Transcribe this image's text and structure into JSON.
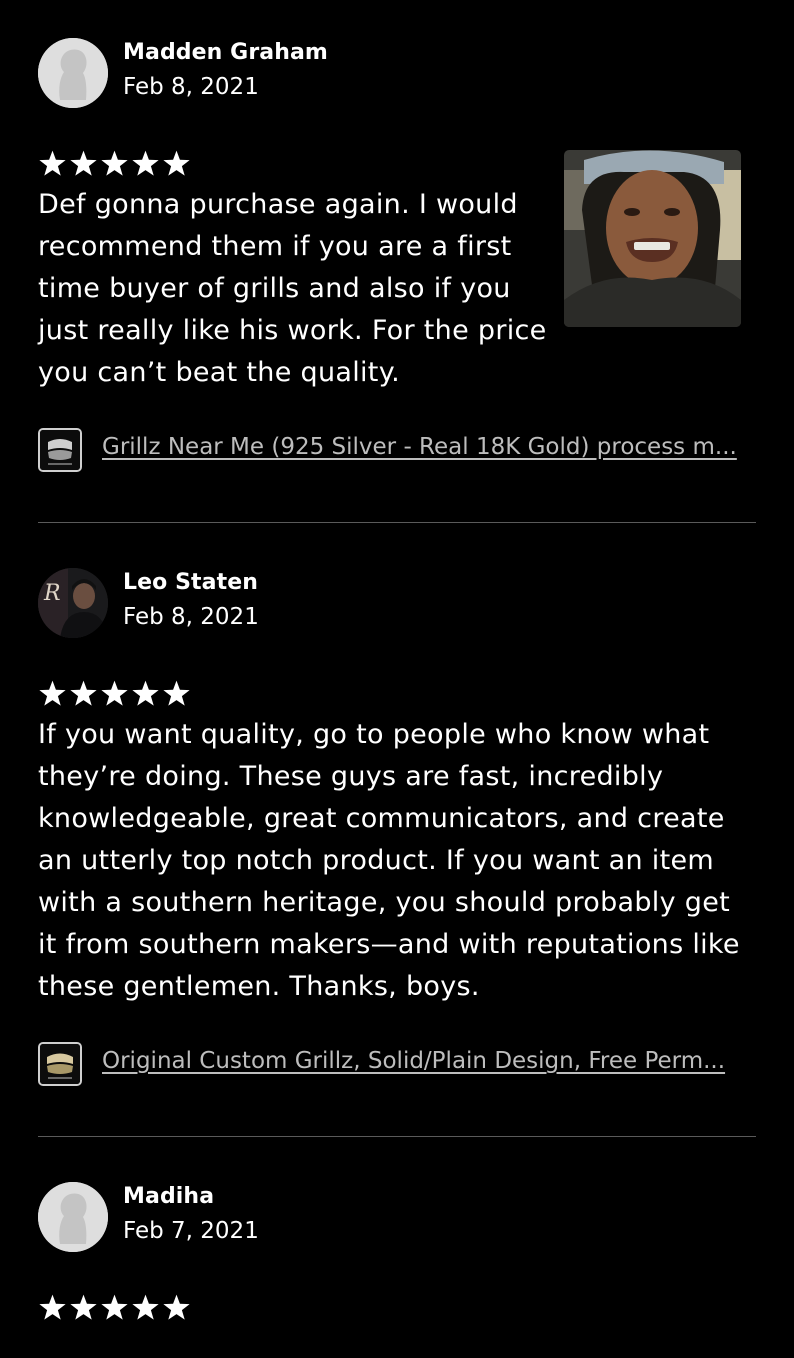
{
  "reviews": [
    {
      "reviewer": "Madden Graham",
      "date": "Feb 8, 2021",
      "rating": 5,
      "text": "Def gonna purchase again. I would recommend them if you are a first time buyer of grills and also if you just really like his work. For the price you can’t beat the quality.",
      "item": "Grillz Near Me (925 Silver - Real 18K Gold) process m...",
      "has_photo": true
    },
    {
      "reviewer": "Leo Staten",
      "date": "Feb 8, 2021",
      "rating": 5,
      "text": "If you want quality, go to people who know what they’re doing. These guys are fast, incredibly knowledgeable, great communicators, and create an utterly top notch product. If you want an item with a southern heritage, you should probably get it from southern makers—and with reputations like these gentlemen. Thanks, boys.",
      "item": "Original Custom Grillz, Solid/Plain Design, Free Perm..."
    },
    {
      "reviewer": "Madiha",
      "date": "Feb 7, 2021",
      "rating": 5
    }
  ],
  "colors": {
    "background": "#000000",
    "text": "#ffffff",
    "link": "#bdbdbd",
    "divider": "#5a5a5a"
  },
  "icons": {
    "rating": "star-icon",
    "default_avatar": "person-silhouette-icon",
    "item_thumbnail": "grill-product-thumbnail"
  }
}
